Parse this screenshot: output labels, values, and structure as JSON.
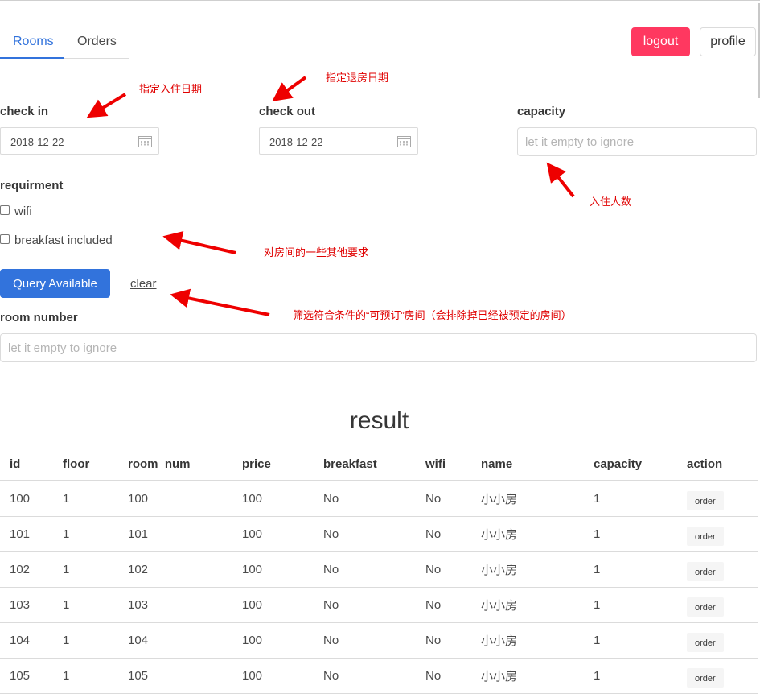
{
  "tabs": [
    {
      "label": "Rooms",
      "active": true
    },
    {
      "label": "Orders",
      "active": false
    }
  ],
  "header": {
    "logout_label": "logout",
    "profile_label": "profile"
  },
  "form": {
    "checkin_label": "check in",
    "checkin_value": "2018-12-22",
    "checkout_label": "check out",
    "checkout_value": "2018-12-22",
    "capacity_label": "capacity",
    "capacity_placeholder": "let it empty to ignore",
    "requirement_label": "requirment",
    "wifi_label": "wifi",
    "breakfast_label": "breakfast included",
    "query_label": "Query Available",
    "clear_label": "clear",
    "room_number_label": "room number",
    "room_number_placeholder": "let it empty to ignore"
  },
  "annotations": {
    "checkin": "指定入住日期",
    "checkout": "指定退房日期",
    "capacity": "入住人数",
    "requirement": "对房间的一些其他要求",
    "query": "筛选符合条件的“可预订”房间（会排除掉已经被预定的房间）"
  },
  "result": {
    "title": "result",
    "columns": [
      "id",
      "floor",
      "room_num",
      "price",
      "breakfast",
      "wifi",
      "name",
      "capacity",
      "action"
    ],
    "rows": [
      [
        "100",
        "1",
        "100",
        "100",
        "No",
        "No",
        "小小房",
        "1",
        "order"
      ],
      [
        "101",
        "1",
        "101",
        "100",
        "No",
        "No",
        "小小房",
        "1",
        "order"
      ],
      [
        "102",
        "1",
        "102",
        "100",
        "No",
        "No",
        "小小房",
        "1",
        "order"
      ],
      [
        "103",
        "1",
        "103",
        "100",
        "No",
        "No",
        "小小房",
        "1",
        "order"
      ],
      [
        "104",
        "1",
        "104",
        "100",
        "No",
        "No",
        "小小房",
        "1",
        "order"
      ],
      [
        "105",
        "1",
        "105",
        "100",
        "No",
        "No",
        "小小房",
        "1",
        "order"
      ]
    ]
  },
  "colors": {
    "primary": "#3273dc",
    "danger": "#ff3860",
    "annotation": "#e00000"
  }
}
